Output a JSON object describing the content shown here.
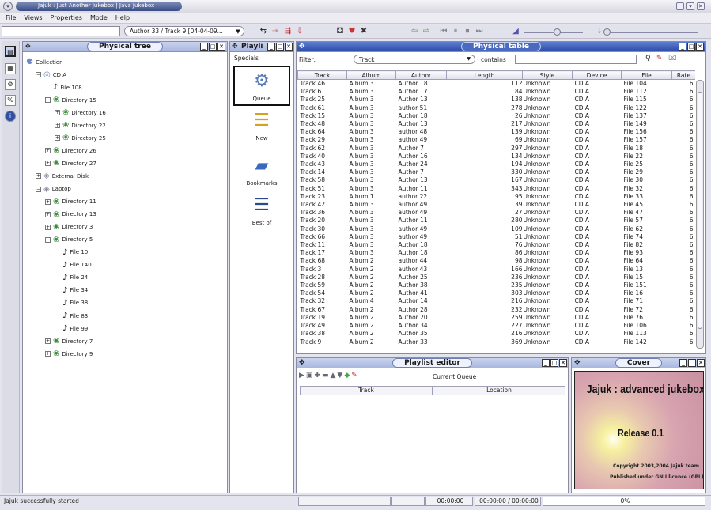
{
  "window": {
    "title": "Jajuk : Just Another Jukebox | Java Jukebox"
  },
  "menu": [
    "File",
    "Views",
    "Properties",
    "Mode",
    "Help"
  ],
  "toolbar": {
    "search_value": "1",
    "history_value": "Author 33 / Track 9 [04-04-09..."
  },
  "physical_tree": {
    "title": "Physical tree",
    "nodes": [
      {
        "label": "Collection",
        "icon": "collection-icon",
        "level": 0
      },
      {
        "label": "CD A",
        "icon": "cd-icon",
        "level": 1
      },
      {
        "label": "File 108",
        "icon": "music-note-icon",
        "level": 2
      },
      {
        "label": "Directory 15",
        "icon": "directory-icon",
        "level": 2
      },
      {
        "label": "Directory 16",
        "icon": "directory-icon",
        "level": 3
      },
      {
        "label": "Directory 22",
        "icon": "directory-icon",
        "level": 3
      },
      {
        "label": "Directory 25",
        "icon": "directory-icon",
        "level": 3
      },
      {
        "label": "Directory 26",
        "icon": "directory-icon",
        "level": 2
      },
      {
        "label": "Directory 27",
        "icon": "directory-icon",
        "level": 2
      },
      {
        "label": "External Disk",
        "icon": "disk-icon",
        "level": 1
      },
      {
        "label": "Laptop",
        "icon": "laptop-icon",
        "level": 1
      },
      {
        "label": "Directory 11",
        "icon": "directory-icon",
        "level": 2
      },
      {
        "label": "Directory 13",
        "icon": "directory-icon",
        "level": 2
      },
      {
        "label": "Directory 3",
        "icon": "directory-icon",
        "level": 2
      },
      {
        "label": "Directory 5",
        "icon": "directory-icon",
        "level": 2
      },
      {
        "label": "File 10",
        "icon": "music-note-icon",
        "level": 3
      },
      {
        "label": "File 140",
        "icon": "music-note-icon",
        "level": 3
      },
      {
        "label": "File 24",
        "icon": "music-note-icon",
        "level": 3
      },
      {
        "label": "File 34",
        "icon": "music-note-icon",
        "level": 3
      },
      {
        "label": "File 38",
        "icon": "music-note-icon",
        "level": 3
      },
      {
        "label": "File 83",
        "icon": "music-note-icon",
        "level": 3
      },
      {
        "label": "File 99",
        "icon": "music-note-icon",
        "level": 3
      },
      {
        "label": "Directory 7",
        "icon": "directory-icon",
        "level": 2
      },
      {
        "label": "Directory 9",
        "icon": "directory-icon",
        "level": 2
      }
    ]
  },
  "playlists": {
    "title": "Playli",
    "section": "Specials",
    "items": [
      {
        "label": "Queue",
        "icon": "queue-gear-icon"
      },
      {
        "label": "New",
        "icon": "new-star-icon"
      },
      {
        "label": "Bookmarks",
        "icon": "bookmarks-folder-icon"
      },
      {
        "label": "Best of",
        "icon": "best-of-icon"
      }
    ]
  },
  "physical_table": {
    "title": "Physical table",
    "filter_label": "Filter:",
    "filter_value": "Track",
    "contains_label": "contains :",
    "contains_value": "",
    "columns": [
      "Track",
      "Album",
      "Author",
      "Length",
      "Style",
      "Device",
      "File",
      "Rate"
    ],
    "rows": [
      [
        "Track 46",
        "Album 3",
        "Author 18",
        "112",
        "Unknown",
        "CD A",
        "File 104",
        "6"
      ],
      [
        "Track 6",
        "Album 3",
        "Author 17",
        "84",
        "Unknown",
        "CD A",
        "File 112",
        "6"
      ],
      [
        "Track 25",
        "Album 3",
        "Author 13",
        "138",
        "Unknown",
        "CD A",
        "File 115",
        "6"
      ],
      [
        "Track 61",
        "Album 3",
        "author 51",
        "278",
        "Unknown",
        "CD A",
        "File 122",
        "6"
      ],
      [
        "Track 15",
        "Album 3",
        "Author 18",
        "26",
        "Unknown",
        "CD A",
        "File 137",
        "6"
      ],
      [
        "Track 48",
        "Album 3",
        "Author 13",
        "217",
        "Unknown",
        "CD A",
        "File 149",
        "6"
      ],
      [
        "Track 64",
        "Album 3",
        "author 48",
        "139",
        "Unknown",
        "CD A",
        "File 156",
        "6"
      ],
      [
        "Track 29",
        "Album 3",
        "author 49",
        "69",
        "Unknown",
        "CD A",
        "File 157",
        "6"
      ],
      [
        "Track 62",
        "Album 3",
        "Author 7",
        "297",
        "Unknown",
        "CD A",
        "File 18",
        "6"
      ],
      [
        "Track 40",
        "Album 3",
        "Author 16",
        "134",
        "Unknown",
        "CD A",
        "File 22",
        "6"
      ],
      [
        "Track 43",
        "Album 3",
        "Author 24",
        "194",
        "Unknown",
        "CD A",
        "File 25",
        "6"
      ],
      [
        "Track 14",
        "Album 3",
        "Author 7",
        "330",
        "Unknown",
        "CD A",
        "File 29",
        "6"
      ],
      [
        "Track 58",
        "Album 3",
        "Author 13",
        "167",
        "Unknown",
        "CD A",
        "File 30",
        "6"
      ],
      [
        "Track 51",
        "Album 3",
        "Author 11",
        "343",
        "Unknown",
        "CD A",
        "File 32",
        "6"
      ],
      [
        "Track 23",
        "Album 1",
        "author 22",
        "95",
        "Unknown",
        "CD A",
        "File 33",
        "6"
      ],
      [
        "Track 42",
        "Album 3",
        "author 49",
        "39",
        "Unknown",
        "CD A",
        "File 45",
        "6"
      ],
      [
        "Track 36",
        "Album 3",
        "author 49",
        "27",
        "Unknown",
        "CD A",
        "File 47",
        "6"
      ],
      [
        "Track 20",
        "Album 3",
        "Author 11",
        "280",
        "Unknown",
        "CD A",
        "File 57",
        "6"
      ],
      [
        "Track 30",
        "Album 3",
        "author 49",
        "109",
        "Unknown",
        "CD A",
        "File 62",
        "6"
      ],
      [
        "Track 66",
        "Album 3",
        "author 49",
        "51",
        "Unknown",
        "CD A",
        "File 74",
        "6"
      ],
      [
        "Track 11",
        "Album 3",
        "Author 18",
        "76",
        "Unknown",
        "CD A",
        "File 82",
        "6"
      ],
      [
        "Track 17",
        "Album 3",
        "Author 18",
        "86",
        "Unknown",
        "CD A",
        "File 93",
        "6"
      ],
      [
        "Track 68",
        "Album 2",
        "author 44",
        "98",
        "Unknown",
        "CD A",
        "File 64",
        "6"
      ],
      [
        "Track 3",
        "Album 2",
        "author 43",
        "166",
        "Unknown",
        "CD A",
        "File 13",
        "6"
      ],
      [
        "Track 28",
        "Album 2",
        "Author 25",
        "236",
        "Unknown",
        "CD A",
        "File 15",
        "6"
      ],
      [
        "Track 59",
        "Album 2",
        "Author 38",
        "235",
        "Unknown",
        "CD A",
        "File 151",
        "6"
      ],
      [
        "Track 54",
        "Album 2",
        "Author 41",
        "303",
        "Unknown",
        "CD A",
        "File 16",
        "6"
      ],
      [
        "Track 32",
        "Album 4",
        "Author 14",
        "216",
        "Unknown",
        "CD A",
        "File 71",
        "6"
      ],
      [
        "Track 67",
        "Album 2",
        "Author 28",
        "232",
        "Unknown",
        "CD A",
        "File 72",
        "6"
      ],
      [
        "Track 19",
        "Album 2",
        "Author 20",
        "259",
        "Unknown",
        "CD A",
        "File 76",
        "6"
      ],
      [
        "Track 49",
        "Album 2",
        "Author 34",
        "227",
        "Unknown",
        "CD A",
        "File 106",
        "6"
      ],
      [
        "Track 38",
        "Album 2",
        "Author 35",
        "216",
        "Unknown",
        "CD A",
        "File 113",
        "6"
      ],
      [
        "Track 9",
        "Album 2",
        "Author 33",
        "369",
        "Unknown",
        "CD A",
        "File 142",
        "6"
      ]
    ]
  },
  "playlist_editor": {
    "title": "Playlist editor",
    "current": "Current Queue",
    "columns": [
      "Track",
      "Location"
    ]
  },
  "cover": {
    "title": "Cover",
    "headline": "Jajuk : advanced jukebox",
    "release": "Release 0.1",
    "copyright": "Copyright 2003,2004 Jajuk team",
    "licence": "Published under GNU licence (GPL)"
  },
  "status": {
    "message": "Jajuk successfully started",
    "elapsed": "00:00:00",
    "total": "00:00:00 / 00:00:00",
    "progress": "0%"
  }
}
